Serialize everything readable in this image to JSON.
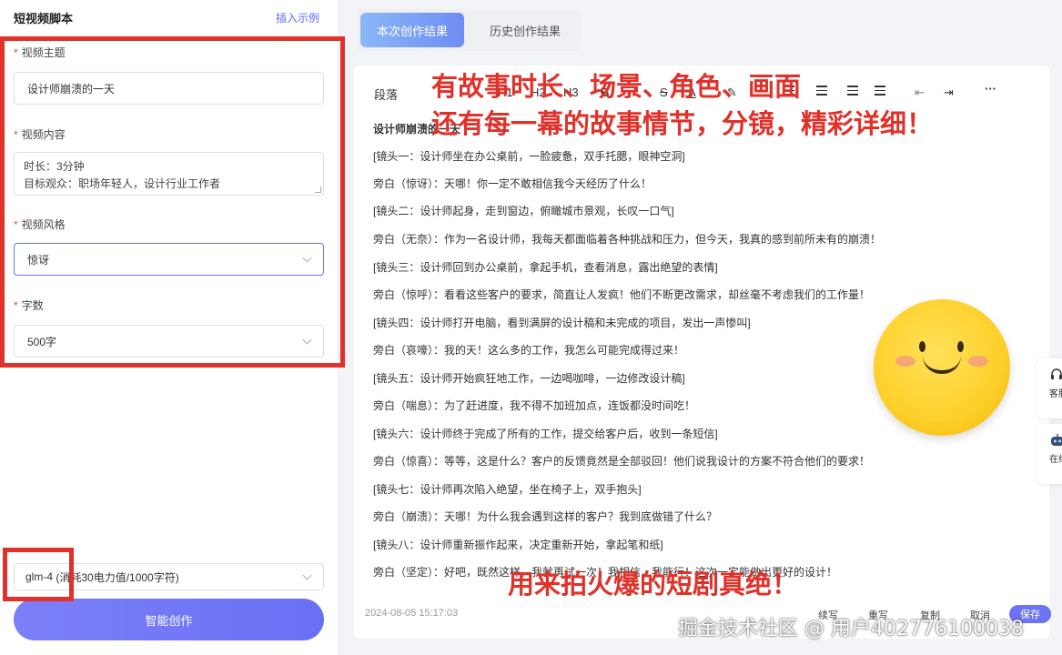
{
  "left_panel": {
    "title": "短视频脚本",
    "insert_example": "插入示例",
    "topic": {
      "label": "视频主题",
      "value": "设计师崩溃的一天"
    },
    "content": {
      "label": "视频内容",
      "value_line1": "时长：3分钟",
      "value_line2": "目标观众：职场年轻人，设计行业工作者"
    },
    "style": {
      "label": "视频风格",
      "value": "惊讶"
    },
    "word_count": {
      "label": "字数",
      "value": "500字"
    },
    "required_mark": "*",
    "model": {
      "name": "glm-4",
      "cost": "(消耗30电力值/1000字符)"
    },
    "generate_button": "智能创作"
  },
  "tabs": [
    {
      "label": "本次创作结果",
      "active": true
    },
    {
      "label": "历史创作结果",
      "active": false
    }
  ],
  "toolbar": {
    "paragraph": "段落",
    "h1": "H1",
    "h2": "H2",
    "h3": "H3",
    "bold": "B",
    "italic": "I",
    "strike": "S",
    "text_color": "A",
    "more": "···"
  },
  "document": {
    "title": "设计师崩溃的一天",
    "lines": [
      "[镜头一：设计师坐在办公桌前，一脸疲惫，双手托腮，眼神空洞]",
      "旁白（惊讶）：天哪！你一定不敢相信我今天经历了什么！",
      "[镜头二：设计师起身，走到窗边，俯瞰城市景观，长叹一口气]",
      "旁白（无奈）：作为一名设计师，我每天都面临着各种挑战和压力，但今天，我真的感到前所未有的崩溃！",
      "[镜头三：设计师回到办公桌前，拿起手机，查看消息，露出绝望的表情]",
      "旁白（惊呼）：看看这些客户的要求，简直让人发疯！他们不断更改需求，却丝毫不考虑我们的工作量！",
      "[镜头四：设计师打开电脑，看到满屏的设计稿和未完成的项目，发出一声惨叫]",
      "旁白（哀嚎）：我的天！这么多的工作，我怎么可能完成得过来！",
      "[镜头五：设计师开始疯狂地工作，一边喝咖啡，一边修改设计稿]",
      "旁白（喘息）：为了赶进度，我不得不加班加点，连饭都没时间吃！",
      "[镜头六：设计师终于完成了所有的工作，提交给客户后，收到一条短信]",
      "旁白（惊喜）：等等，这是什么？客户的反馈竟然是全部驳回！他们说我设计的方案不符合他们的要求！",
      "[镜头七：设计师再次陷入绝望，坐在椅子上，双手抱头]",
      "旁白（崩溃）：天哪！为什么我会遇到这样的客户？我到底做错了什么？",
      "[镜头八：设计师重新振作起来，决定重新开始，拿起笔和纸]",
      "旁白（坚定）：好吧，既然这样，我就再试一次！我相信，我能行！这次一定能做出更好的设计！"
    ]
  },
  "footer": {
    "timestamp": "2024-08-05 15:17:03",
    "continue": "续写",
    "rewrite": "重写",
    "copy": "复制",
    "cancel": "取消",
    "save": "保存"
  },
  "annotations": {
    "top_line1": "有故事时长、场景、角色、画面",
    "top_line2": "还有每一幕的故事情节，分镜，精彩详细！",
    "bottom": "用来拍火爆的短剧真绝！"
  },
  "side_float": {
    "service": "客服",
    "online": "在线"
  },
  "watermark": "掘金技术社区 @ 用户402776100038",
  "colors": {
    "accent": "#6d73f3",
    "annotation_red": "#e0312a",
    "required": "#e84c4c"
  }
}
